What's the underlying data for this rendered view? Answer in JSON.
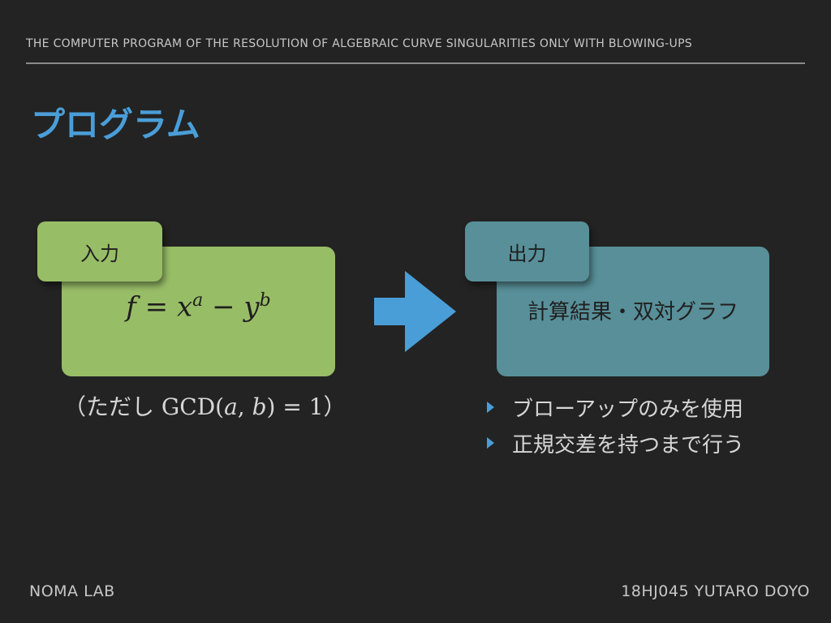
{
  "header": {
    "text": "THE COMPUTER PROGRAM OF THE RESOLUTION OF ALGEBRAIC CURVE SINGULARITIES ONLY WITH BLOWING-UPS"
  },
  "title": "プログラム",
  "input": {
    "tab_label": "入力",
    "formula": {
      "f": "f",
      "eq": " = ",
      "x": "x",
      "a": "a",
      "minus": " − ",
      "y": "y",
      "b": "b"
    },
    "note": {
      "prefix": "（ただし ",
      "gcd": "GCD(",
      "a": "a",
      "comma": ", ",
      "b": "b",
      "suffix": ") = 1",
      "close": "）"
    }
  },
  "output": {
    "tab_label": "出力",
    "result": "計算結果・双対グラフ",
    "bullets": [
      "ブローアップのみを使用",
      "正規交差を持つまで行う"
    ]
  },
  "footer": {
    "left": "NOMA LAB",
    "right": "18HJ045 YUTARO DOYO"
  },
  "colors": {
    "background": "#232323",
    "accent": "#4a9ed8",
    "input_box": "#98bd67",
    "output_box": "#588f98"
  },
  "icons": {
    "arrow": "right-arrow-icon",
    "bullet": "triangle-bullet-icon"
  }
}
